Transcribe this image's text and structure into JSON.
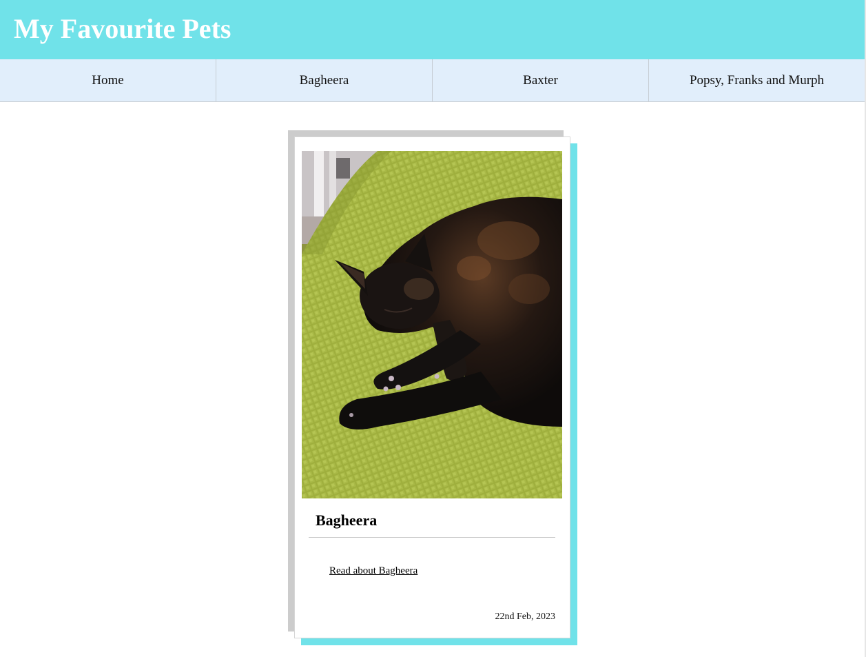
{
  "header": {
    "title": "My Favourite Pets"
  },
  "nav": {
    "items": [
      {
        "label": "Home"
      },
      {
        "label": "Bagheera"
      },
      {
        "label": "Baxter"
      },
      {
        "label": "Popsy, Franks and Murph"
      }
    ]
  },
  "card": {
    "image_icon": "sleeping-cat-photo",
    "title": "Bagheera",
    "link_label": "Read about Bagheera",
    "date": "22nd Feb, 2023"
  },
  "colors": {
    "header_bg": "#70e2e9",
    "nav_bg": "#e1eefb",
    "card_shadow_grey": "#cccccc",
    "card_shadow_teal": "#70e2e9"
  }
}
